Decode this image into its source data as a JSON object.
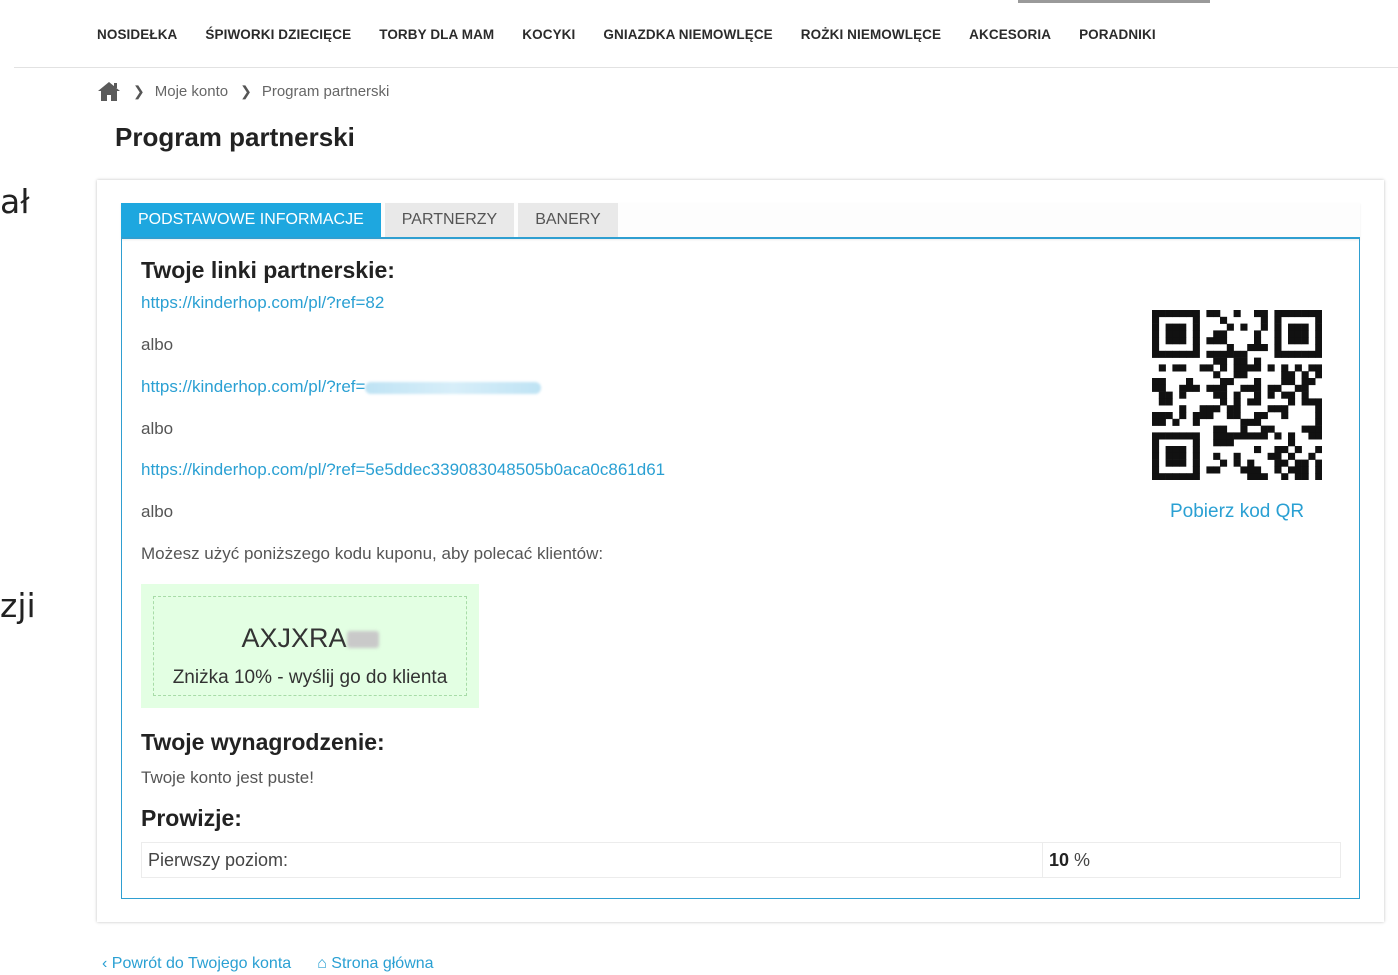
{
  "nav": {
    "items": [
      "NOSIDEŁKA",
      "ŚPIWORKI DZIECIĘCE",
      "TORBY DLA MAM",
      "KOCYKI",
      "GNIAZDKA NIEMOWLĘCE",
      "ROŻKI NIEMOWLĘCE",
      "AKCESORIA",
      "PORADNIKI"
    ]
  },
  "left_fragments": [
    "ał",
    "zji"
  ],
  "breadcrumb": {
    "home_icon": "home-icon",
    "items": [
      "Moje konto",
      "Program partnerski"
    ]
  },
  "page_title": "Program partnerski",
  "tabs": [
    "PODSTAWOWE INFORMACJE",
    "PARTNERZY",
    "BANERY"
  ],
  "links_section": {
    "heading": "Twoje linki partnerskie:",
    "link1": "https://kinderhop.com/pl/?ref=82",
    "link2_prefix": "https://kinderhop.com/pl/?ref=",
    "link3": "https://kinderhop.com/pl/?ref=5e5ddec339083048505b0aca0c861d61",
    "or": "albo",
    "coupon_intro": "Możesz użyć poniższego kodu kuponu, aby polecać klientów:"
  },
  "coupon": {
    "code": "AXJXRA",
    "description": "Zniżka 10% - wyślij go do klienta"
  },
  "qr": {
    "download_label": "Pobierz kod QR"
  },
  "earnings": {
    "heading": "Twoje wynagrodzenie:",
    "status": "Twoje konto jest puste!"
  },
  "commissions": {
    "heading": "Prowizje:",
    "level_label": "Pierwszy poziom:",
    "value": "10",
    "unit": "%"
  },
  "footer": {
    "back_label": "Powrót do Twojego konta",
    "home_label": "Strona główna"
  },
  "colors": {
    "accent": "#1ea7df",
    "link": "#2aa0d3",
    "coupon_bg": "#e3ffe3"
  }
}
